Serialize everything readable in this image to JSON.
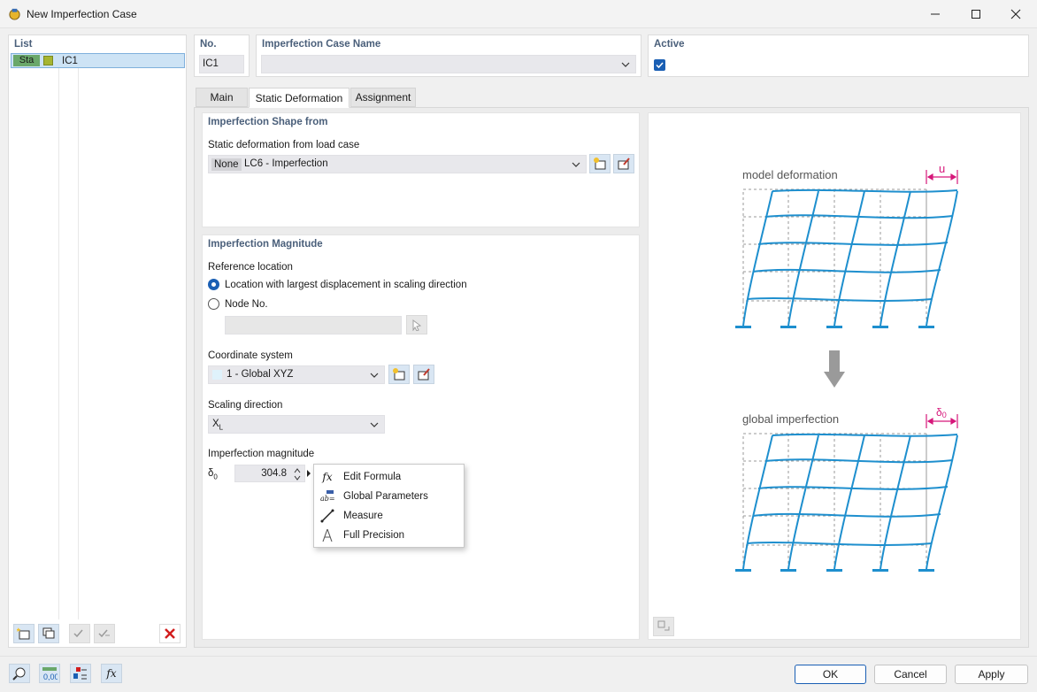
{
  "window": {
    "title": "New Imperfection Case",
    "minimize_icon": "minimize-icon",
    "maximize_icon": "maximize-icon",
    "close_icon": "close-icon"
  },
  "list": {
    "header": "List",
    "item": {
      "tag": "Sta",
      "name": "IC1"
    }
  },
  "no": {
    "label": "No.",
    "value": "IC1"
  },
  "name": {
    "label": "Imperfection Case Name",
    "value": ""
  },
  "active": {
    "label": "Active",
    "checked": true
  },
  "tabs": [
    "Main",
    "Static Deformation",
    "Assignment"
  ],
  "shape": {
    "header": "Imperfection Shape from",
    "label": "Static deformation from load case",
    "badge": "None",
    "value": "LC6 - Imperfection"
  },
  "magnitude": {
    "header": "Imperfection Magnitude",
    "ref_label": "Reference location",
    "opt1": "Location with largest displacement in scaling direction",
    "opt2": "Node No.",
    "selected": 1,
    "cs_label": "Coordinate system",
    "cs_value": "1 - Global XYZ",
    "dir_label": "Scaling direction",
    "dir_value": "X",
    "dir_sub": "L",
    "mag_label": "Imperfection magnitude",
    "symbol": "δ",
    "symbol_sub": "0",
    "value": "304.8"
  },
  "context_menu": {
    "items": [
      {
        "label": "Edit Formula",
        "icon": "fx-icon"
      },
      {
        "label": "Global Parameters",
        "icon": "ab-parameters-icon"
      },
      {
        "label": "Measure",
        "icon": "measure-icon"
      },
      {
        "label": "Full Precision",
        "icon": "precision-icon"
      }
    ]
  },
  "diagram": {
    "top_label": "model deformation",
    "top_dim": "u",
    "bottom_label": "global imperfection",
    "bottom_dim": "δ",
    "bottom_dim_sub": "0",
    "frame_color": "#1e8fce",
    "dim_color": "#d6177a"
  },
  "footer": {
    "ok": "OK",
    "cancel": "Cancel",
    "apply": "Apply"
  },
  "colors": {
    "accent": "#1a5fb4",
    "tag": "#6aa86a",
    "header_text": "#4a5f7a"
  }
}
